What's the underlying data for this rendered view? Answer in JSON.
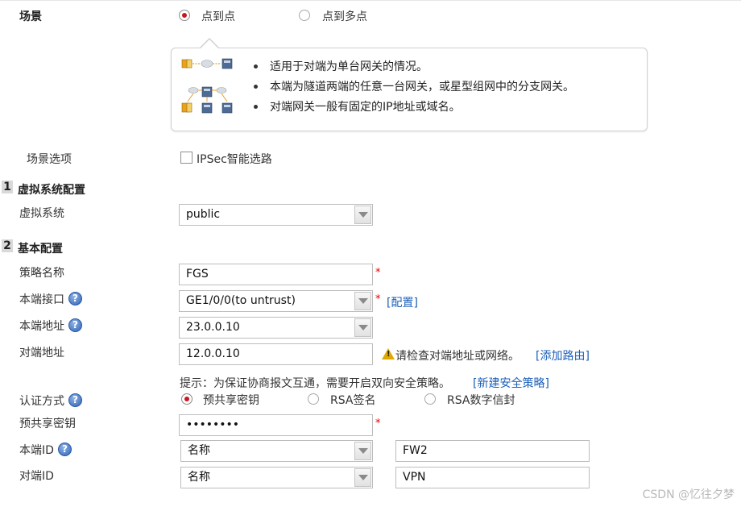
{
  "scene": {
    "label": "场景",
    "options": [
      {
        "label": "点到点",
        "selected": true
      },
      {
        "label": "点到多点",
        "selected": false
      }
    ],
    "info_bullets": [
      "适用于对端为单台网关的情况。",
      "本端为隧道两端的任意一台网关，或星型组网中的分支网关。",
      "对端网关一般有固定的IP地址或域名。"
    ]
  },
  "scene_options": {
    "label": "场景选项",
    "checkbox_label": "IPSec智能选路",
    "checked": false
  },
  "section1": {
    "num": "1",
    "title": "虚拟系统配置"
  },
  "virtual_system": {
    "label": "虚拟系统",
    "value": "public"
  },
  "section2": {
    "num": "2",
    "title": "基本配置"
  },
  "policy_name": {
    "label": "策略名称",
    "value": "FGS",
    "required": "*"
  },
  "local_interface": {
    "label": "本端接口",
    "value": "GE1/0/0(to untrust)",
    "required": "*",
    "link": "[配置]"
  },
  "local_address": {
    "label": "本端地址",
    "value": "23.0.0.10"
  },
  "peer_address": {
    "label": "对端地址",
    "value": "12.0.0.10",
    "warning": "请检查对端地址或网络。",
    "link": "[添加路由]"
  },
  "hint": {
    "text": "提示：为保证协商报文互通，需要开启双向安全策略。",
    "link": "[新建安全策略]"
  },
  "auth_method": {
    "label": "认证方式",
    "options": [
      {
        "label": "预共享密钥",
        "selected": true
      },
      {
        "label": "RSA签名",
        "selected": false
      },
      {
        "label": "RSA数字信封",
        "selected": false
      }
    ]
  },
  "psk": {
    "label": "预共享密钥",
    "value": "••••••••",
    "required": "*"
  },
  "local_id": {
    "label": "本端ID",
    "type": "名称",
    "value": "FW2"
  },
  "peer_id": {
    "label": "对端ID",
    "type": "名称",
    "value": "VPN"
  },
  "help_glyph": "?",
  "watermark": "CSDN @忆往夕梦",
  "colors": {
    "radio_selected": "#c8161d",
    "link": "#1b5fb8",
    "required": "#e00000",
    "warning": "#e0a800"
  }
}
